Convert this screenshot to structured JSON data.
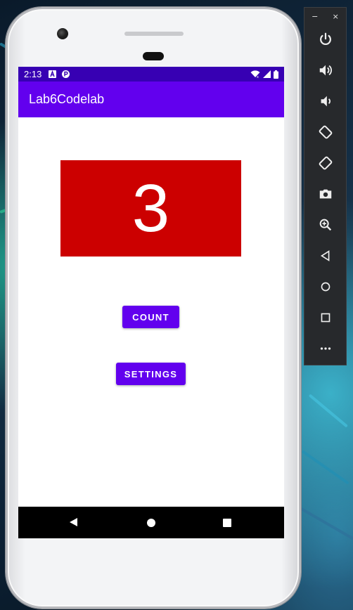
{
  "status_bar": {
    "time": "2:13",
    "icons_left": [
      "a-notification-icon",
      "p-notification-icon"
    ],
    "icons_right": [
      "wifi-icon",
      "signal-icon",
      "battery-icon"
    ]
  },
  "app_bar": {
    "title": "Lab6Codelab"
  },
  "main": {
    "count_display": "3",
    "count_button_label": "COUNT",
    "settings_button_label": "SETTINGS"
  },
  "nav_bar": {
    "buttons": [
      "back",
      "home",
      "recents"
    ]
  },
  "emulator_toolbar": {
    "window_controls": [
      "−",
      "×"
    ],
    "buttons": [
      "power",
      "volume-up",
      "volume-down",
      "rotate-left",
      "rotate-right",
      "screenshot",
      "zoom",
      "back",
      "home",
      "overview",
      "more"
    ]
  },
  "colors": {
    "status_bar": "#3700b3",
    "app_bar": "#6200ee",
    "counter_background": "#cc0000",
    "button": "#6200ee"
  }
}
